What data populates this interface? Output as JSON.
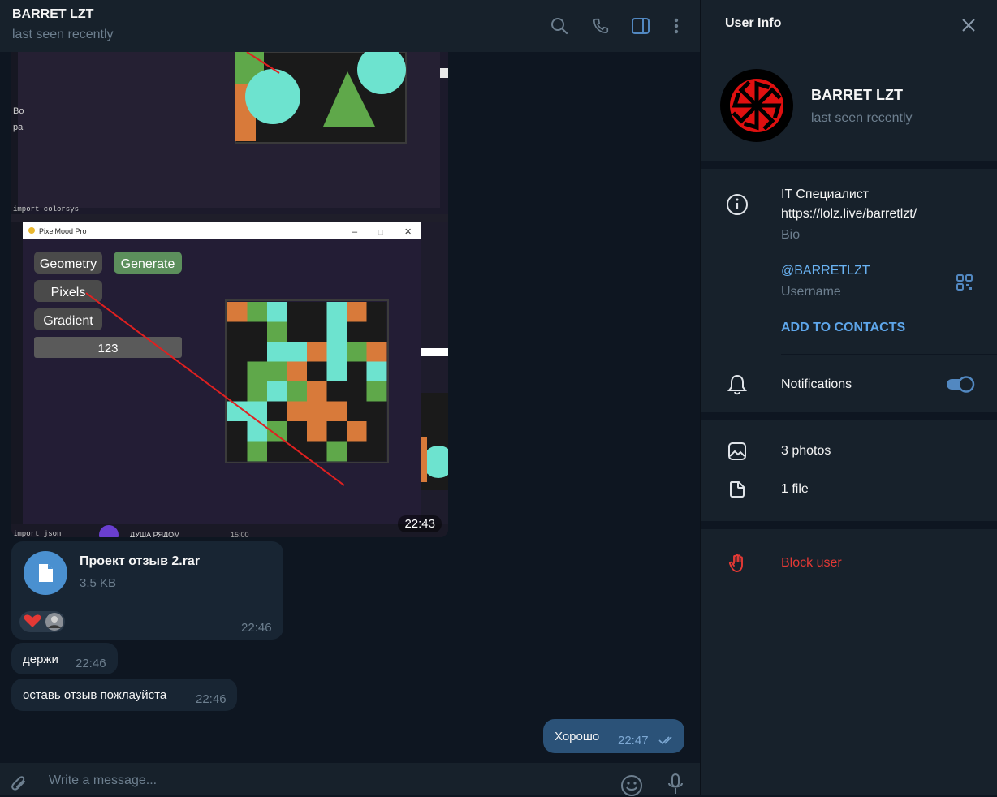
{
  "chat": {
    "title": "BARRET LZT",
    "status": "last seen recently",
    "header_icons": [
      "search-icon",
      "phone-icon",
      "sidebar-toggle-icon",
      "more-vertical-icon"
    ]
  },
  "photo_message": {
    "time": "22:43",
    "app_window": {
      "title": "PixelMood Pro",
      "buttons": [
        "Geometry",
        "Generate",
        "Pixels",
        "Gradient"
      ],
      "input_value": "123"
    }
  },
  "file_message": {
    "name": "Проект отзыв 2.rar",
    "size": "3.5 KB",
    "time": "22:46"
  },
  "messages_in": [
    {
      "text": "держи",
      "time": "22:46"
    },
    {
      "text": "оставь отзыв пожлауйста",
      "time": "22:46"
    }
  ],
  "message_out": {
    "text": "Хорошо",
    "time": "22:47"
  },
  "composer": {
    "placeholder": "Write a message..."
  },
  "panel": {
    "title": "User Info",
    "name": "BARRET LZT",
    "status": "last seen recently",
    "bio_line1": "IT Специалист",
    "bio_line2": "https://lolz.live/barretlzt/",
    "bio_label": "Bio",
    "username": "@BARRETLZT",
    "username_label": "Username",
    "add_contacts": "ADD TO CONTACTS",
    "notifications": "Notifications",
    "notifications_on": true,
    "photos": "3 photos",
    "files": "1 file",
    "block": "Block user"
  },
  "colors": {
    "accent": "#5288c1",
    "danger": "#e53935",
    "panel_bg": "#17212b",
    "chat_bg": "#0e1621",
    "out_bubble": "#2b5278",
    "in_bubble": "#182533",
    "link": "#6ab3f3"
  }
}
